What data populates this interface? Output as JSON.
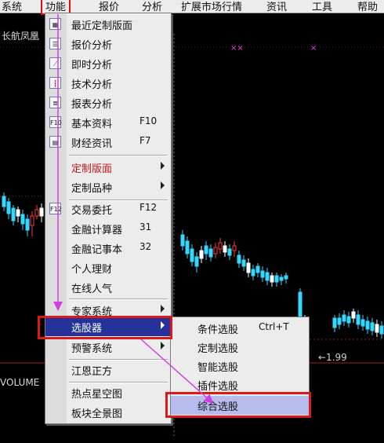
{
  "menubar": [
    "系统",
    "功能",
    "报价",
    "分析",
    "扩展市场行情",
    "资讯",
    "工具",
    "帮助"
  ],
  "stock_name": "长航凤凰",
  "volume_label": "VOLUME",
  "price_label": "←1.99",
  "markers": [
    "××",
    "×"
  ],
  "menu": {
    "g1": [
      {
        "label": "最近定制版面",
        "icon": "layout-icon"
      },
      {
        "label": "报价分析",
        "icon": "list-icon"
      },
      {
        "label": "即时分析",
        "icon": "line-chart-icon"
      },
      {
        "label": "技术分析",
        "icon": "candlestick-icon"
      },
      {
        "label": "报表分析",
        "icon": "report-icon"
      },
      {
        "label": "基本资料",
        "icon": "f10-icon",
        "glyph": "F10",
        "shortcut": "F10"
      },
      {
        "label": "财经资讯",
        "icon": "news-icon",
        "shortcut": "F7"
      }
    ],
    "g2": [
      {
        "label": "定制版面"
      },
      {
        "label": "定制品种"
      }
    ],
    "g3": [
      {
        "label": "交易委托",
        "icon": "f12-icon",
        "glyph": "F12",
        "shortcut": "F12"
      },
      {
        "label": "金融计算器",
        "shortcut": "31"
      },
      {
        "label": "金融记事本",
        "shortcut": "32"
      },
      {
        "label": "个人理财"
      },
      {
        "label": "在线人气"
      }
    ],
    "g4": [
      {
        "label": "专家系统"
      },
      {
        "label": "选股器"
      },
      {
        "label": "预警系统"
      }
    ],
    "g5": [
      {
        "label": "江恩正方"
      }
    ],
    "g6": [
      {
        "label": "热点星空图"
      },
      {
        "label": "板块全景图"
      }
    ]
  },
  "submenu": [
    {
      "label": "条件选股",
      "shortcut": "Ctrl+T"
    },
    {
      "label": "定制选股"
    },
    {
      "label": "智能选股"
    },
    {
      "label": "插件选股"
    },
    {
      "label": "综合选股"
    }
  ],
  "colors": {
    "up": "#ff3a3a",
    "down": "#33d8ff",
    "neutral": "#ffffff",
    "highlight": "#27319a",
    "annotation": "#d81a1a",
    "arrow": "#d040e0"
  }
}
